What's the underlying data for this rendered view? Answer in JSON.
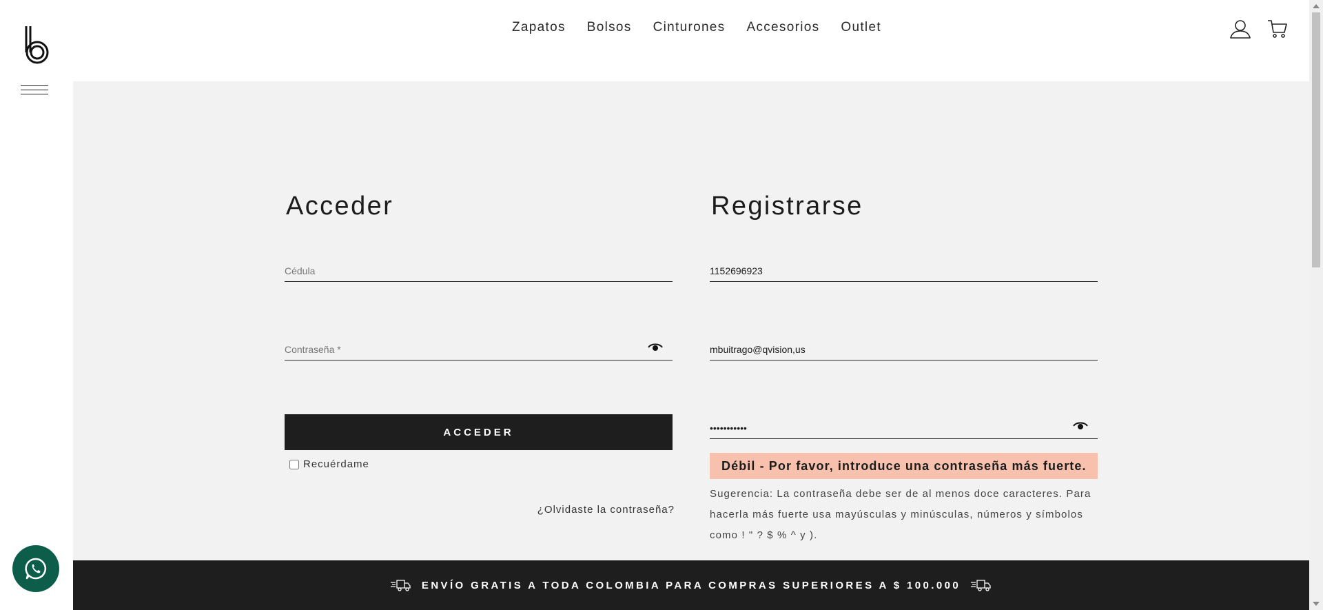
{
  "brand": {
    "logo_icon": "brand-b-logo"
  },
  "nav": {
    "items": [
      {
        "label": "Zapatos"
      },
      {
        "label": "Bolsos"
      },
      {
        "label": "Cinturones"
      },
      {
        "label": "Accesorios"
      },
      {
        "label": "Outlet"
      }
    ]
  },
  "header_icons": {
    "account": "user-icon",
    "cart": "cart-icon"
  },
  "login": {
    "title": "Acceder",
    "id_field": {
      "placeholder": "Cédula",
      "value": ""
    },
    "password_field": {
      "placeholder": "Contraseña *",
      "value": ""
    },
    "submit_label": "ACCEDER",
    "remember_label": "Recuérdame",
    "forgot_label": "¿Olvidaste la contraseña?"
  },
  "register": {
    "title": "Registrarse",
    "id_field": {
      "value": "1152696923"
    },
    "email_field": {
      "value": "mbuitrago@qvision,us"
    },
    "password_field": {
      "value": "•••••••••••"
    },
    "strength_message": "Débil - Por favor, introduce una contraseña más fuerte.",
    "hint_text": "Sugerencia: La contraseña debe ser de al menos doce caracteres. Para hacerla más fuerte usa mayúsculas y minúsculas, números y símbolos como ! \" ? $ % ^ y )."
  },
  "banner": {
    "text": "ENVÍO GRATIS A TODA COLOMBIA PARA COMPRAS SUPERIORES A $ 100.000"
  },
  "colors": {
    "dark": "#1e1e1e",
    "panel": "#f2f2f2",
    "weak_password_bg": "#f8c1ad",
    "whatsapp": "#0c5e4b"
  }
}
